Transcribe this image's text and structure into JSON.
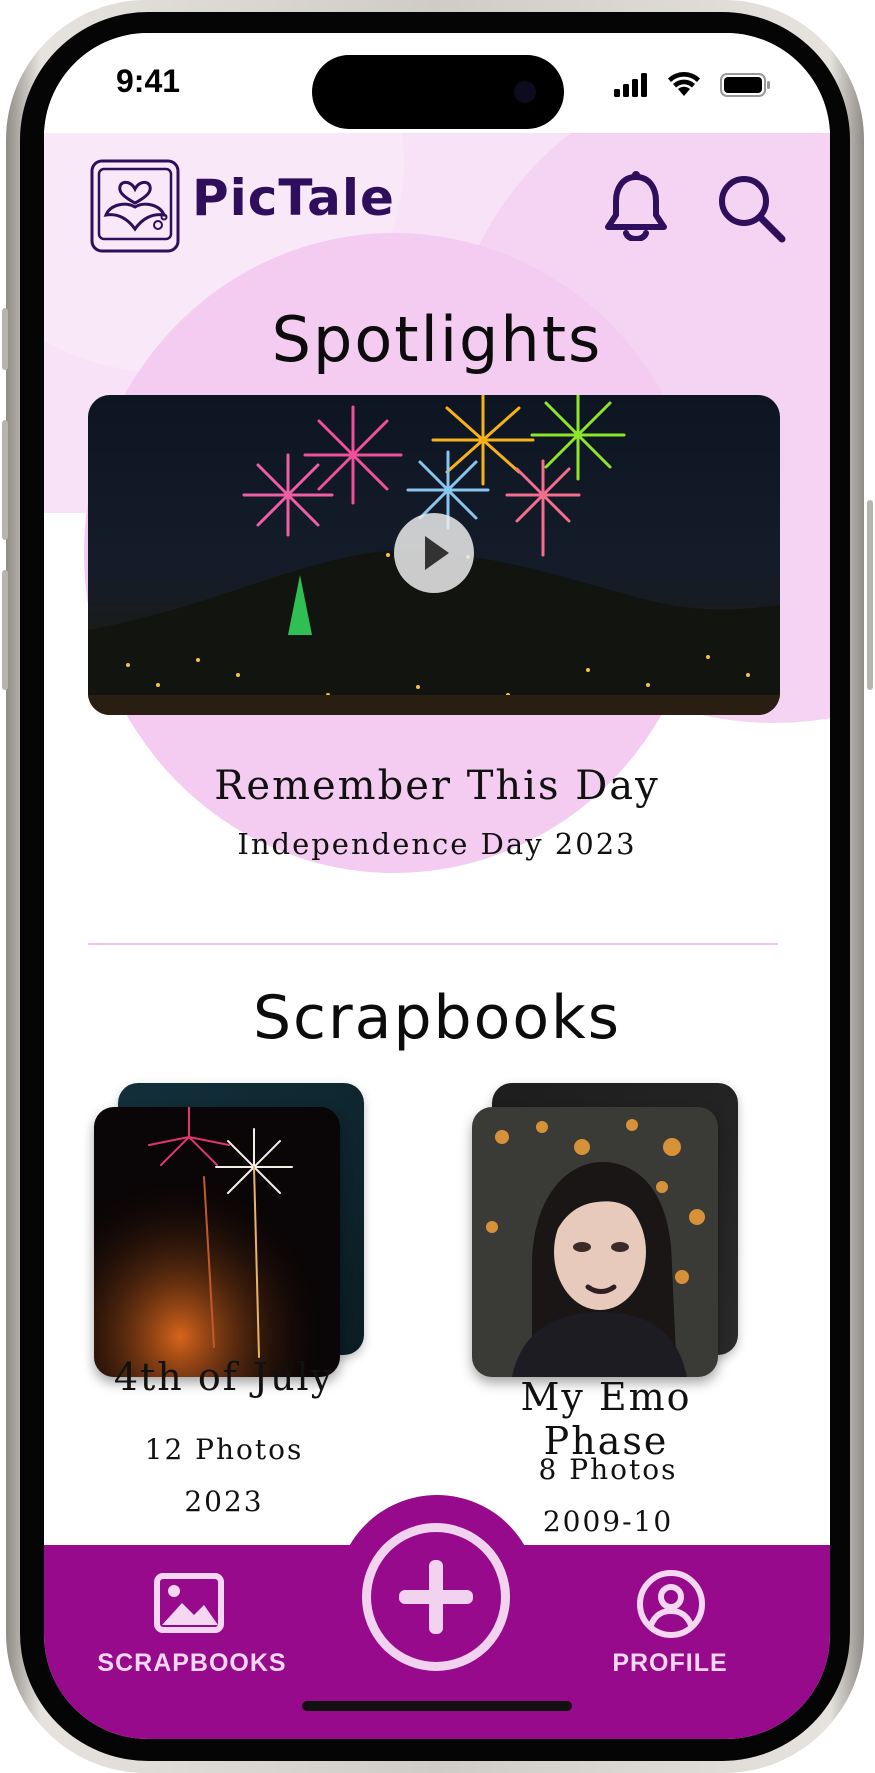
{
  "status_bar": {
    "time": "9:41"
  },
  "header": {
    "brand": "PicTale"
  },
  "spotlights": {
    "heading": "Spotlights",
    "title": "Remember This Day",
    "subtitle": "Independence Day 2023"
  },
  "scrapbooks": {
    "heading": "Scrapbooks",
    "items": [
      {
        "title": "4th of July",
        "count": "12 Photos",
        "year": "2023"
      },
      {
        "title": "My Emo Phase",
        "count": "8 Photos",
        "year": "2009-10"
      }
    ]
  },
  "nav": {
    "scrapbooks_label": "SCRAPBOOKS",
    "profile_label": "PROFILE"
  },
  "colors": {
    "brand": "#2f0e5c",
    "nav": "#960a8b",
    "nav_text": "#f4d8f2",
    "pink_bg": "#f8e2f7"
  },
  "icons": [
    "bell-icon",
    "search-icon",
    "play-icon",
    "gallery-icon",
    "add-icon",
    "profile-icon",
    "logo-icon"
  ]
}
